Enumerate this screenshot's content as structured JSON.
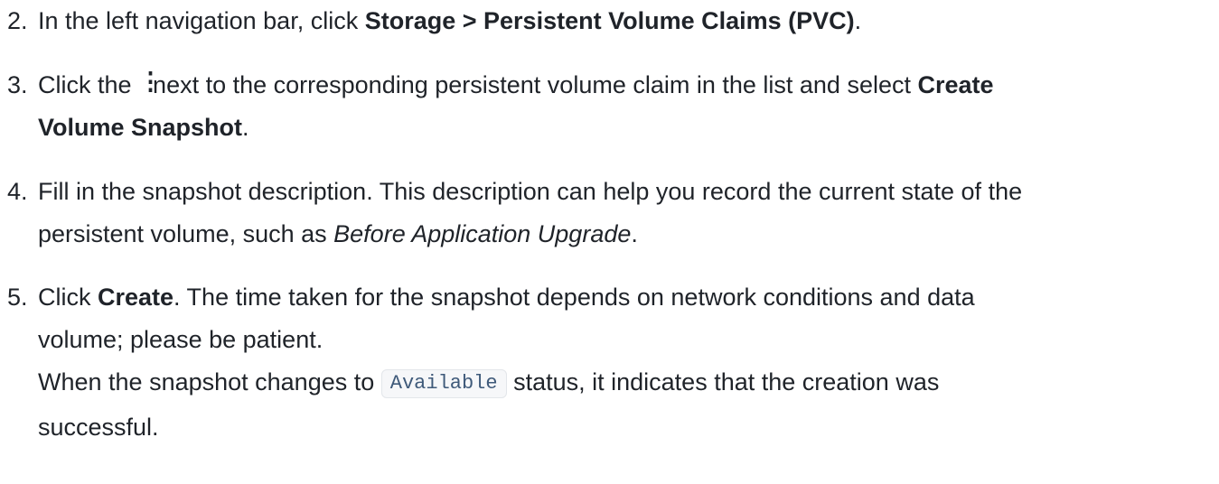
{
  "steps": [
    {
      "number": "2.",
      "lines": [
        [
          "In the left navigation bar, click ",
          "Storage > Persistent Volume Claims (PVC)",
          "."
        ]
      ]
    },
    {
      "number": "3.",
      "lines": [
        [
          "Click the ",
          "next to the corresponding persistent volume claim in the list and select ",
          "Create"
        ],
        [
          "Volume Snapshot",
          "."
        ]
      ],
      "icon": "more-vertical-icon"
    },
    {
      "number": "4.",
      "lines": [
        [
          "Fill in the snapshot description. This description can help you record the current state of the"
        ],
        [
          "persistent volume, such as ",
          "Before Application Upgrade",
          "."
        ]
      ]
    },
    {
      "number": "5.",
      "lines": [
        [
          "Click ",
          "Create",
          ". The time taken for the snapshot depends on network conditions and data"
        ],
        [
          "volume; please be patient."
        ],
        [
          "When the snapshot changes to ",
          "Available",
          " status, it indicates that the creation was"
        ],
        [
          "successful."
        ]
      ]
    }
  ]
}
